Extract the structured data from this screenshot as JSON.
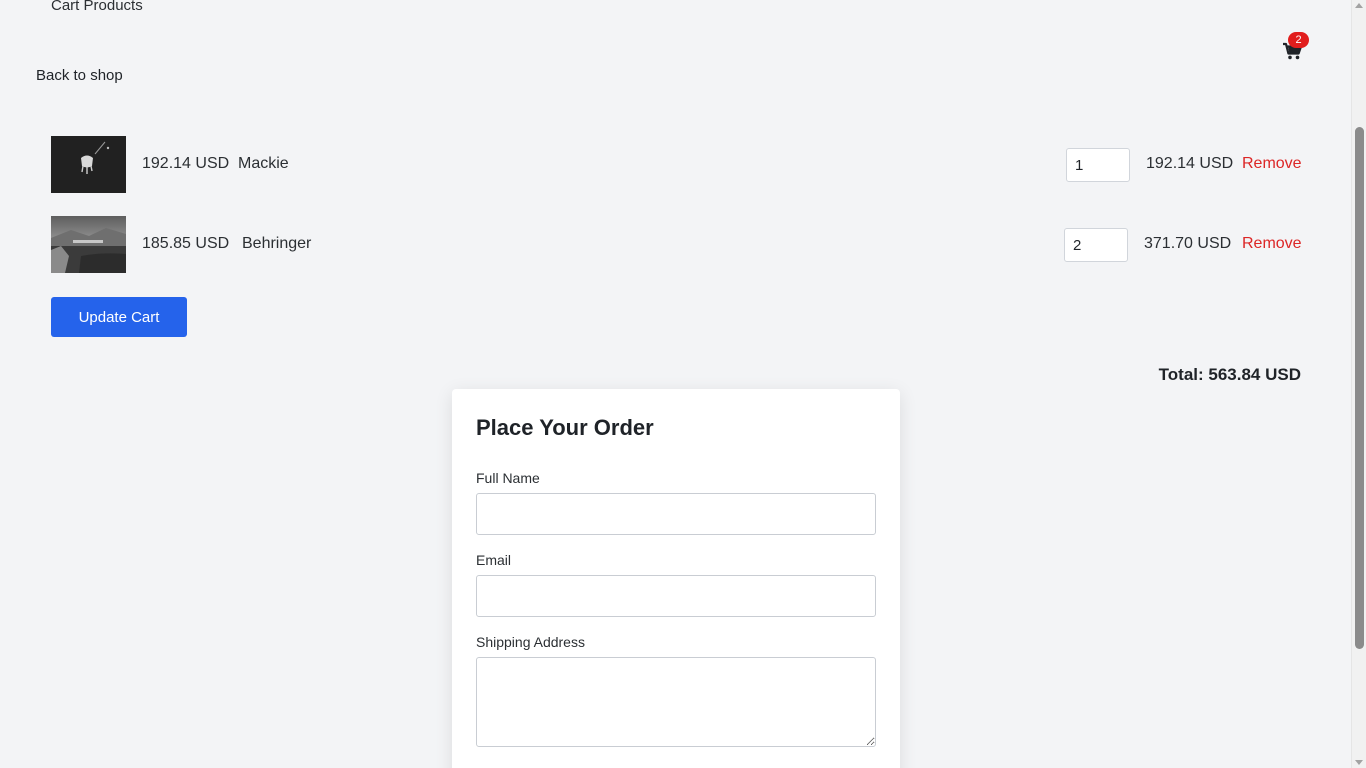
{
  "header": {
    "section_title": "Cart Products",
    "back_link": "Back to shop",
    "cart_count": "2",
    "cart_icon": "shopping-cart-icon"
  },
  "cart": {
    "items": [
      {
        "unit_price": "192.14 USD",
        "name": "Mackie",
        "quantity": "1",
        "line_total": "192.14 USD",
        "remove_label": "Remove",
        "thumbnail": "dark product photo"
      },
      {
        "unit_price": "185.85 USD",
        "name": "Behringer",
        "quantity": "2",
        "line_total": "371.70 USD",
        "remove_label": "Remove",
        "thumbnail": "grayscale landscape photo"
      }
    ],
    "update_label": "Update Cart",
    "total": "Total: 563.84 USD"
  },
  "order_form": {
    "title": "Place Your Order",
    "full_name_label": "Full Name",
    "full_name_value": "",
    "email_label": "Email",
    "email_value": "",
    "address_label": "Shipping Address",
    "address_value": ""
  },
  "colors": {
    "background": "#f3f4f6",
    "primary_button": "#2563eb",
    "remove_link": "#dc2626",
    "badge": "#e11d1d"
  }
}
